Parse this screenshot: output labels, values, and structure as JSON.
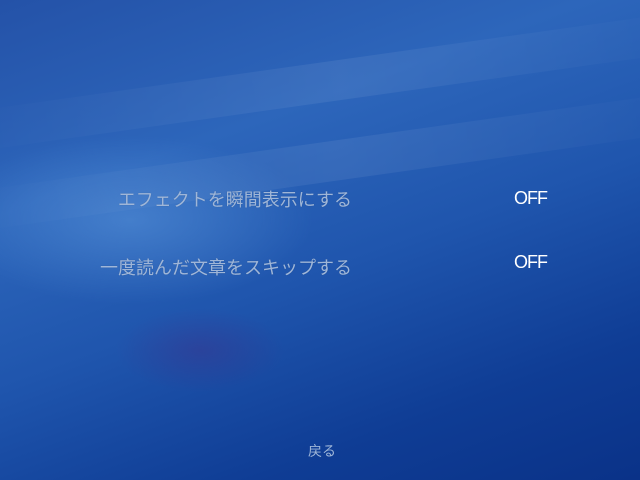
{
  "options": [
    {
      "label": "エフェクトを瞬間表示にする",
      "value": "OFF"
    },
    {
      "label": "一度読んだ文章をスキップする",
      "value": "OFF"
    }
  ],
  "back_label": "戻る"
}
